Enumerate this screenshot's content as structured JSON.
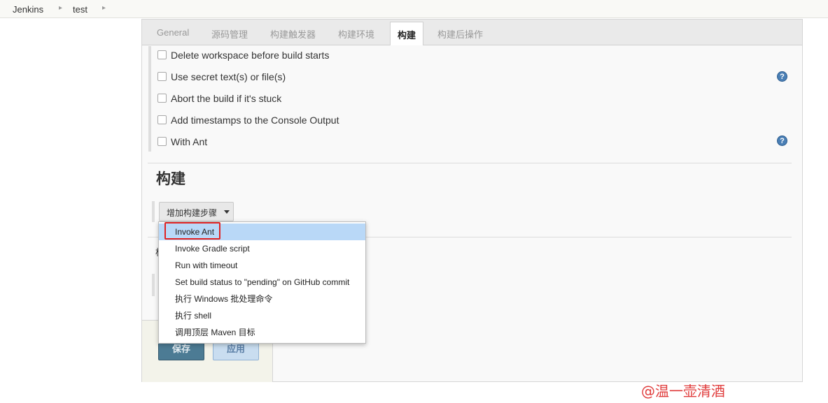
{
  "breadcrumb": [
    "Jenkins",
    "test"
  ],
  "tabs": [
    {
      "label": "General",
      "active": false
    },
    {
      "label": "源码管理",
      "active": false
    },
    {
      "label": "构建触发器",
      "active": false
    },
    {
      "label": "构建环境",
      "active": false
    },
    {
      "label": "构建",
      "active": true
    },
    {
      "label": "构建后操作",
      "active": false
    }
  ],
  "build_env_options": [
    {
      "label": "Delete workspace before build starts",
      "checked": false,
      "help": false
    },
    {
      "label": "Use secret text(s) or file(s)",
      "checked": false,
      "help": true
    },
    {
      "label": "Abort the build if it's stuck",
      "checked": false,
      "help": false
    },
    {
      "label": "Add timestamps to the Console Output",
      "checked": false,
      "help": false
    },
    {
      "label": "With Ant",
      "checked": false,
      "help": true
    }
  ],
  "help_icon_glyph": "?",
  "build_section": {
    "title": "构建",
    "add_step_label": "增加构建步骤"
  },
  "hidden_fragment": "构",
  "add_step_menu": {
    "items": [
      {
        "label": "Invoke Ant",
        "highlighted": true
      },
      {
        "label": "Invoke Gradle script",
        "highlighted": false
      },
      {
        "label": "Run with timeout",
        "highlighted": false
      },
      {
        "label": "Set build status to \"pending\" on GitHub commit",
        "highlighted": false
      },
      {
        "label": "执行 Windows 批处理命令",
        "highlighted": false
      },
      {
        "label": "执行 shell",
        "highlighted": false
      },
      {
        "label": "调用顶层 Maven 目标",
        "highlighted": false
      }
    ]
  },
  "buttons": {
    "save": "保存",
    "apply": "应用"
  },
  "watermark": "@温一壶清酒",
  "colors": {
    "save_button": "#4c7b94",
    "apply_button": "#c9ddf0",
    "menu_highlight": "#b9d8f7",
    "annotation_box": "#e02222",
    "help_icon": "#4a7fb5"
  }
}
